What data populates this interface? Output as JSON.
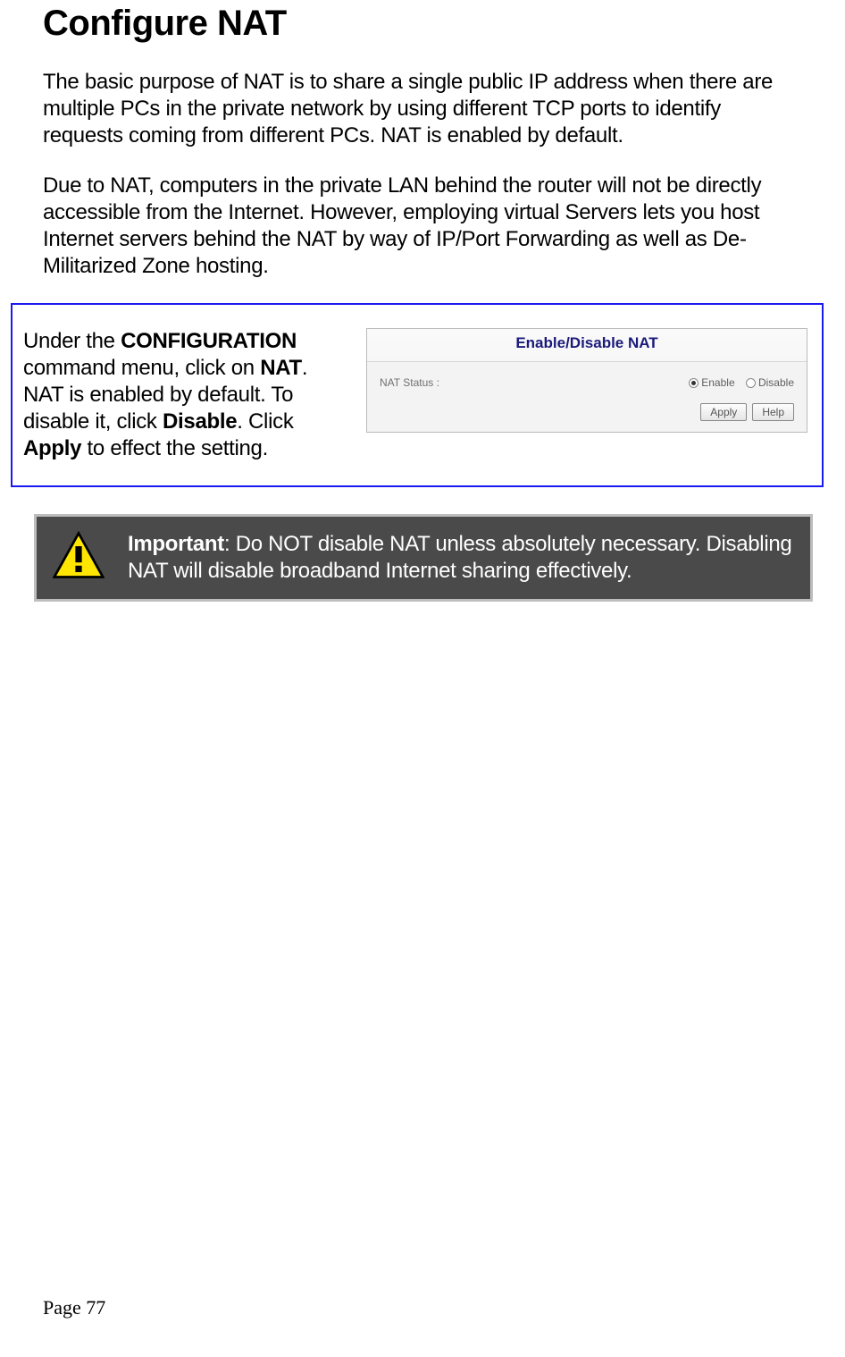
{
  "heading": "Configure NAT",
  "para1": "The basic purpose of NAT is to share a single public IP address when there are multiple PCs in the private network by using different TCP ports to identify requests coming from different PCs. NAT is enabled by default.",
  "para2": "Due to NAT, computers in the private LAN behind the router will not be directly accessible from the Internet. However, employing virtual Servers lets you host Internet servers behind the NAT by way of IP/Port Forwarding as well as De-Militarized Zone hosting.",
  "instruction": {
    "pre1": "Under the ",
    "bold1": "CONFIGURATION",
    "mid1": " command menu, click on ",
    "bold2": "NAT",
    "mid2": ". NAT is enabled by default. To disable it, click ",
    "bold3": "Disable",
    "mid3": ". Click ",
    "bold4": "Apply",
    "post": " to effect the setting."
  },
  "panel": {
    "title": "Enable/Disable NAT",
    "status_label": "NAT Status :",
    "enable_label": "Enable",
    "disable_label": "Disable",
    "apply_btn": "Apply",
    "help_btn": "Help"
  },
  "important": {
    "label": "Important",
    "text": ": Do NOT disable NAT unless absolutely necessary. Disabling NAT will disable broadband Internet sharing effectively."
  },
  "page_number": "Page 77"
}
